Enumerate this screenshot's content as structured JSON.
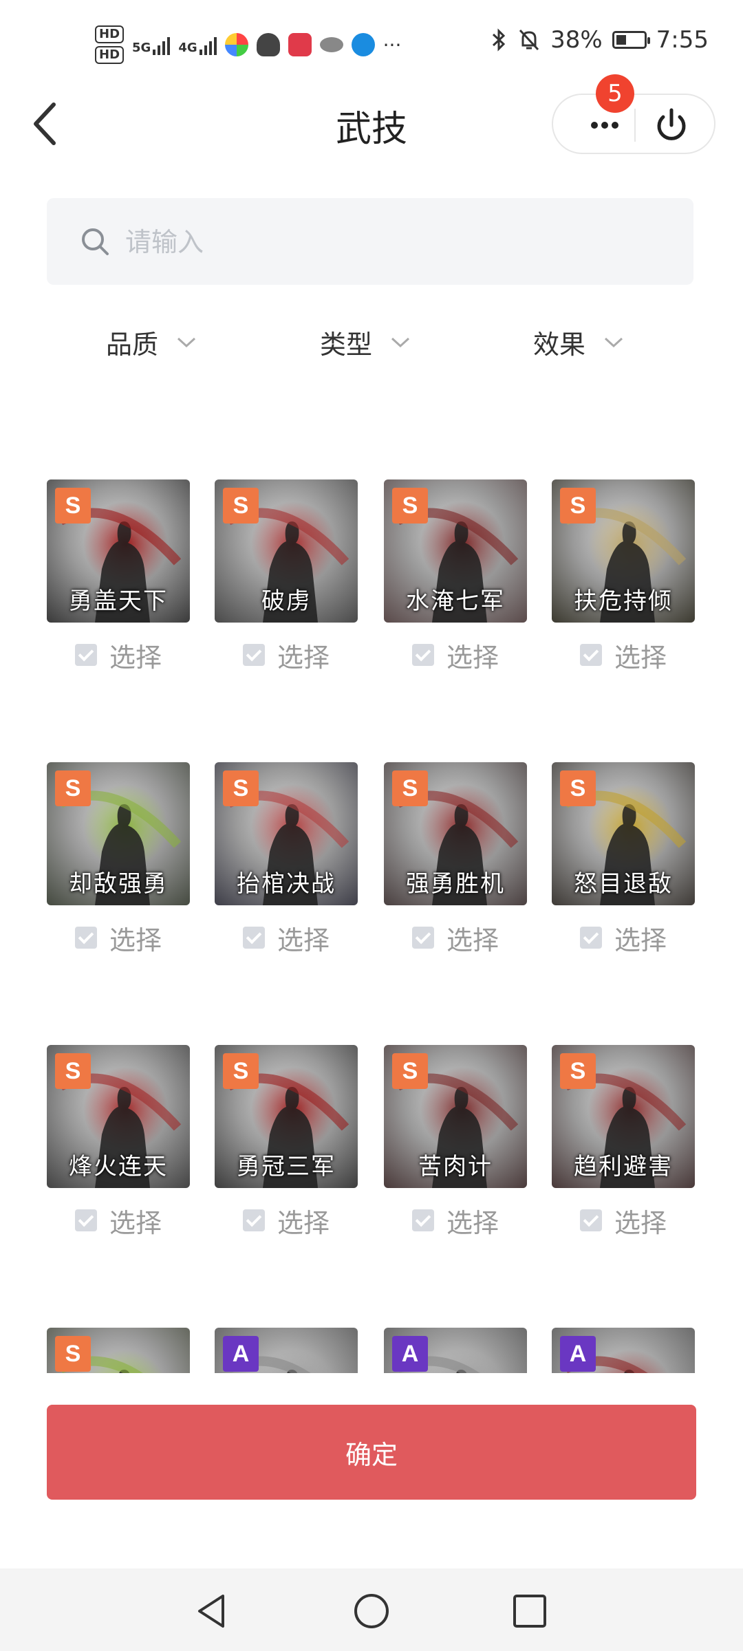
{
  "status_bar": {
    "hd1": "HD",
    "hd2": "HD",
    "net1": "5G",
    "net2": "4G",
    "more": "···",
    "battery_percent": "38%",
    "battery_level": 0.38,
    "time": "7:55"
  },
  "header": {
    "title": "武技",
    "badge_count": "5"
  },
  "search": {
    "placeholder": "请输入",
    "value": ""
  },
  "filters": [
    {
      "label": "品质"
    },
    {
      "label": "类型"
    },
    {
      "label": "效果"
    }
  ],
  "select_label": "选择",
  "skills": [
    {
      "name": "勇盖天下",
      "rank": "S",
      "theme": "#3a3a3a",
      "accent": "#9a1a1a"
    },
    {
      "name": "破虏",
      "rank": "S",
      "theme": "#4a4a4a",
      "accent": "#a33030"
    },
    {
      "name": "水淹七军",
      "rank": "S",
      "theme": "#5a4a4a",
      "accent": "#7a2525"
    },
    {
      "name": "扶危持倾",
      "rank": "S",
      "theme": "#3c3a30",
      "accent": "#b8a060"
    },
    {
      "name": "却敌强勇",
      "rank": "S",
      "theme": "#454a40",
      "accent": "#8ab040"
    },
    {
      "name": "抬棺决战",
      "rank": "S",
      "theme": "#3e3e48",
      "accent": "#b04040"
    },
    {
      "name": "强勇胜机",
      "rank": "S",
      "theme": "#4a4040",
      "accent": "#8a2a2a"
    },
    {
      "name": "怒目退敌",
      "rank": "S",
      "theme": "#3e3a36",
      "accent": "#c0a030"
    },
    {
      "name": "烽火连天",
      "rank": "S",
      "theme": "#444",
      "accent": "#a02a2a"
    },
    {
      "name": "勇冠三军",
      "rank": "S",
      "theme": "#3d3d3d",
      "accent": "#9a2020"
    },
    {
      "name": "苦肉计",
      "rank": "S",
      "theme": "#4a3a3a",
      "accent": "#7a2a2a"
    },
    {
      "name": "趋利避害",
      "rank": "S",
      "theme": "#483838",
      "accent": "#8a2a2a"
    },
    {
      "name": "",
      "rank": "S",
      "theme": "#4a4e40",
      "accent": "#8ab040"
    },
    {
      "name": "",
      "rank": "A",
      "theme": "#555",
      "accent": "#888"
    },
    {
      "name": "",
      "rank": "A",
      "theme": "#555",
      "accent": "#888"
    },
    {
      "name": "",
      "rank": "A",
      "theme": "#555",
      "accent": "#8a2a2a"
    }
  ],
  "confirm_label": "确定",
  "colors": {
    "confirm": "#e05a5d",
    "rank_s": "#ef7844",
    "rank_a": "#6a37c2",
    "badge": "#f0432f"
  }
}
